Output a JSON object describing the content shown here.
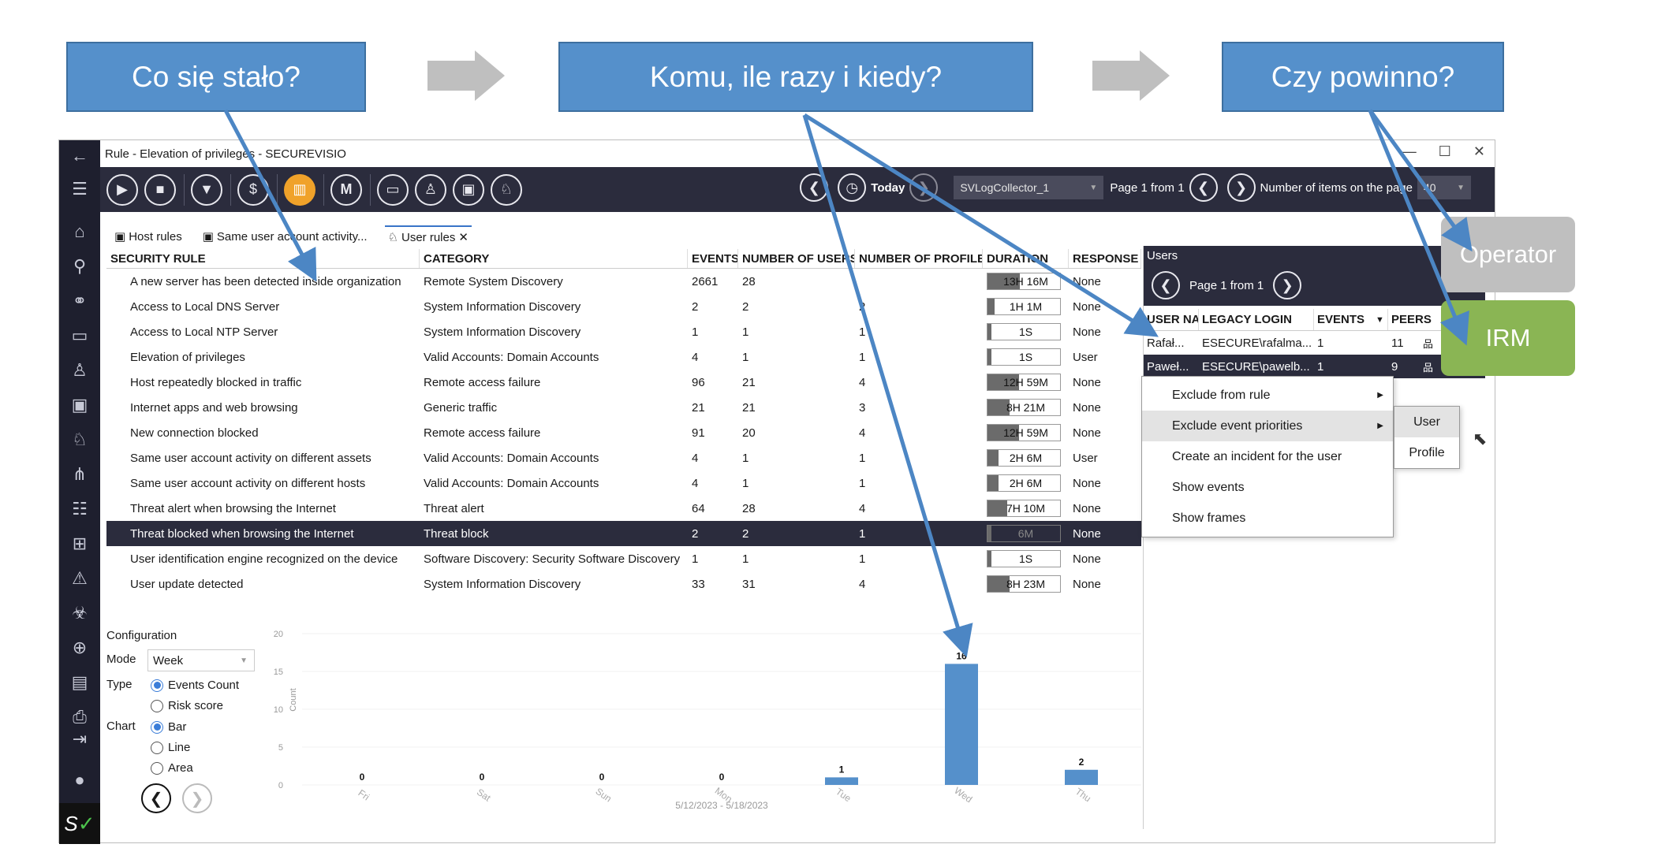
{
  "callouts": {
    "c1": "Co się stało?",
    "c2": "Komu, ile razy i kiedy?",
    "c3": "Czy powinno?"
  },
  "tags": {
    "operator": "Operator",
    "irm": "IRM"
  },
  "colors": {
    "callout": "#5590cb",
    "operator": "#bfbfbf",
    "irm": "#8ab554",
    "toolbar": "#2b2c3d",
    "active_tool": "#f0a22a",
    "bar": "#5590cb"
  },
  "window": {
    "title": "Rule - Elevation of privileges -  SECUREVISIO"
  },
  "toolbar": {
    "today": "Today",
    "collector": "SVLogCollector_1",
    "page_info": "Page 1 from 1",
    "items_label": "Number of items on the page",
    "items_value": "40"
  },
  "tabs": [
    {
      "label": "Host rules"
    },
    {
      "label": "Same user account activity..."
    },
    {
      "label": "User rules"
    }
  ],
  "rules": {
    "columns": [
      "SECURITY RULE",
      "CATEGORY",
      "EVENTS",
      "NUMBER OF USERS",
      "NUMBER OF PROFILES",
      "DURATION",
      "RESPONSE"
    ],
    "rows": [
      {
        "rule": "A new server has been detected inside organization",
        "category": "Remote System Discovery",
        "events": "2661",
        "users": "28",
        "profiles": "",
        "duration": "13H 16M",
        "fill": 0.45,
        "response": "None"
      },
      {
        "rule": "Access to Local DNS Server",
        "category": "System Information Discovery",
        "events": "2",
        "users": "2",
        "profiles": "2",
        "duration": "1H 1M",
        "fill": 0.1,
        "response": "None"
      },
      {
        "rule": "Access to Local NTP Server",
        "category": "System Information Discovery",
        "events": "1",
        "users": "1",
        "profiles": "1",
        "duration": "1S",
        "fill": 0.02,
        "response": "None"
      },
      {
        "rule": "Elevation of privileges",
        "category": "Valid Accounts: Domain Accounts",
        "events": "4",
        "users": "1",
        "profiles": "1",
        "duration": "1S",
        "fill": 0.02,
        "response": "User"
      },
      {
        "rule": "Host repeatedly blocked in traffic",
        "category": "Remote access failure",
        "events": "96",
        "users": "21",
        "profiles": "4",
        "duration": "12H 59M",
        "fill": 0.43,
        "response": "None"
      },
      {
        "rule": "Internet apps and web browsing",
        "category": "Generic traffic",
        "events": "21",
        "users": "21",
        "profiles": "3",
        "duration": "8H 21M",
        "fill": 0.3,
        "response": "None"
      },
      {
        "rule": "New connection blocked",
        "category": "Remote access failure",
        "events": "91",
        "users": "20",
        "profiles": "4",
        "duration": "12H 59M",
        "fill": 0.43,
        "response": "None"
      },
      {
        "rule": "Same user account activity on different assets",
        "category": "Valid Accounts: Domain Accounts",
        "events": "4",
        "users": "1",
        "profiles": "1",
        "duration": "2H 6M",
        "fill": 0.15,
        "response": "User"
      },
      {
        "rule": "Same user account activity on different hosts",
        "category": "Valid Accounts: Domain Accounts",
        "events": "4",
        "users": "1",
        "profiles": "1",
        "duration": "2H 6M",
        "fill": 0.15,
        "response": "None"
      },
      {
        "rule": "Threat alert when browsing the Internet",
        "category": "Threat alert",
        "events": "64",
        "users": "28",
        "profiles": "4",
        "duration": "7H 10M",
        "fill": 0.27,
        "response": "None"
      },
      {
        "rule": "Threat blocked when browsing the Internet",
        "category": "Threat block",
        "events": "2",
        "users": "2",
        "profiles": "1",
        "duration": "6M",
        "fill": 0.05,
        "response": "None",
        "selected": true
      },
      {
        "rule": "User identification engine recognized on the device",
        "category": "Software Discovery: Security Software Discovery",
        "events": "1",
        "users": "1",
        "profiles": "1",
        "duration": "1S",
        "fill": 0.02,
        "response": "None"
      },
      {
        "rule": "User update detected",
        "category": "System Information Discovery",
        "events": "33",
        "users": "31",
        "profiles": "4",
        "duration": "8H 23M",
        "fill": 0.3,
        "response": "None"
      }
    ]
  },
  "config": {
    "title": "Configuration",
    "mode_label": "Mode",
    "mode_value": "Week",
    "type_label": "Type",
    "type_options": [
      "Events Count",
      "Risk score"
    ],
    "chart_label": "Chart",
    "chart_options": [
      "Bar",
      "Line",
      "Area"
    ]
  },
  "chart_data": {
    "type": "bar",
    "categories": [
      "Fri",
      "Sat",
      "Sun",
      "Mon",
      "Tue",
      "Wed",
      "Thu"
    ],
    "values": [
      0,
      0,
      0,
      0,
      1,
      16,
      2
    ],
    "ylabel": "Count",
    "ylim": [
      0,
      20
    ],
    "yticks": [
      0,
      5,
      10,
      15,
      20
    ],
    "date_range": "5/12/2023 - 5/18/2023"
  },
  "users": {
    "title": "Users",
    "page_info": "Page 1 from 1",
    "columns": [
      "USER NA",
      "LEGACY LOGIN",
      "EVENTS",
      "PEERS"
    ],
    "rows": [
      {
        "name": "Rafał...",
        "login": "ESECURE\\rafalma...",
        "events": "1",
        "peers": "11"
      },
      {
        "name": "Paweł...",
        "login": "ESECURE\\pawelb...",
        "events": "1",
        "peers": "9",
        "selected": true
      }
    ]
  },
  "context_menu": {
    "items": [
      "Exclude from rule",
      "Exclude event priorities",
      "Create an incident for the user",
      "Show events",
      "Show frames"
    ],
    "submenu": [
      "User",
      "Profile"
    ]
  }
}
